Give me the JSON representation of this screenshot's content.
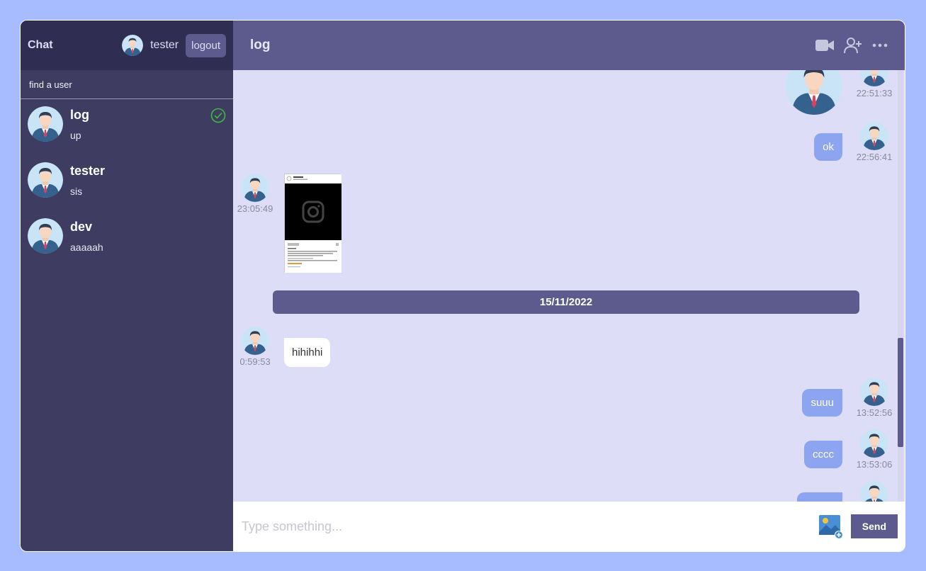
{
  "sidebar": {
    "logo": "Chat",
    "user": "tester",
    "logout_label": "logout",
    "search_placeholder": "find a user",
    "chats": [
      {
        "name": "log",
        "last": "up"
      },
      {
        "name": "tester",
        "last": "sis"
      },
      {
        "name": "dev",
        "last": "aaaaah"
      }
    ]
  },
  "chat": {
    "title": "log",
    "icons": [
      "video-camera-icon",
      "add-user-icon",
      "more-icon"
    ],
    "messages": {
      "m1_time": "22:51:33",
      "m2_text": "ok",
      "m2_time": "22:56:41",
      "m3_time": "23:05:49",
      "date_separator": "15/11/2022",
      "m4_text": "hihihhi",
      "m4_time": "0:59:53",
      "m5_text": "suuu",
      "m5_time": "13:52:56",
      "m6_text": "cccc",
      "m6_time": "13:53:06"
    },
    "input_placeholder": "Type something...",
    "send_label": "Send"
  },
  "colors": {
    "background": "#a7bcff",
    "sidebar": "#3e3c61",
    "navbar": "#2f2d52",
    "header": "#5d5b8d",
    "chat_bg": "#ddddf7",
    "owner_bubble": "#8da4f1"
  }
}
